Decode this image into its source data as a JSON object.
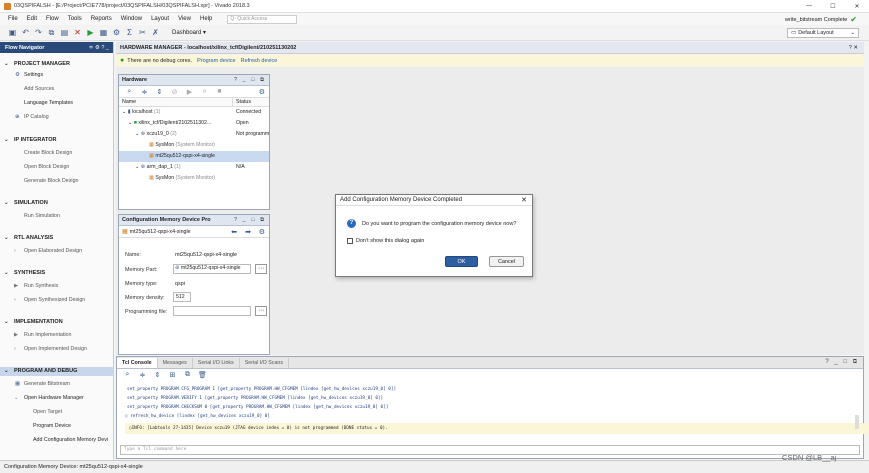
{
  "window": {
    "title": "03QSPIFALSH - [E:/Project/PCIE778/project/03QSPIFALSH/03QSPIFALSH.xpr] - Vivado 2018.3",
    "minimize": "—",
    "maximize": "☐",
    "close": "✕"
  },
  "menu": [
    "File",
    "Edit",
    "Flow",
    "Tools",
    "Reports",
    "Window",
    "Layout",
    "View",
    "Help"
  ],
  "quick_access": {
    "placeholder": "Q- Quick Access"
  },
  "status_right": "write_bitstream Complete",
  "toolbar": {
    "dashboard": "Dashboard ▾",
    "layout": "Default Layout"
  },
  "flow_navigator": {
    "title": "Flow Navigator",
    "header_icons": "≑ ⚙ ? _",
    "sections": [
      {
        "label": "PROJECT MANAGER",
        "items": [
          "Settings",
          "Add Sources",
          "Language Templates",
          "IP Catalog"
        ]
      },
      {
        "label": "IP INTEGRATOR",
        "items": [
          "Create Block Design",
          "Open Block Design",
          "Generate Block Design"
        ]
      },
      {
        "label": "SIMULATION",
        "items": [
          "Run Simulation"
        ]
      },
      {
        "label": "RTL ANALYSIS",
        "items": [
          "Open Elaborated Design"
        ]
      },
      {
        "label": "SYNTHESIS",
        "items": [
          "Run Synthesis",
          "Open Synthesized Design"
        ]
      },
      {
        "label": "IMPLEMENTATION",
        "items": [
          "Run Implementation",
          "Open Implemented Design"
        ]
      },
      {
        "label": "PROGRAM AND DEBUG",
        "items": [
          "Generate Bitstream",
          "Open Hardware Manager",
          "Open Target",
          "Program Device",
          "Add Configuration Memory Devi"
        ]
      }
    ]
  },
  "hardware_manager": {
    "header": "HARDWARE MANAGER - localhost/xilinx_tcf/Digilent/210251130202",
    "info": "There are no debug cores.",
    "link_program": "Program device",
    "link_refresh": "Refresh device"
  },
  "hardware_panel": {
    "title": "Hardware",
    "header_icons": "? _ □ ⧉",
    "columns": [
      "Name",
      "Status"
    ],
    "rows": [
      {
        "name": "localhost",
        "count": "(1)",
        "status": "Connected"
      },
      {
        "name": "xilinx_tcf/Digilent/2102511302...",
        "count": "",
        "status": "Open"
      },
      {
        "name": "xczu19_0",
        "count": "(2)",
        "status": "Not programmed"
      },
      {
        "name": "SysMon",
        "count": "(System Monitor)",
        "status": ""
      },
      {
        "name": "mt25qu512-qspi-x4-single",
        "count": "",
        "status": ""
      },
      {
        "name": "arm_dap_1",
        "count": "(1)",
        "status": "N/A"
      },
      {
        "name": "SysMon",
        "count": "(System Monitor)",
        "status": ""
      }
    ]
  },
  "config_panel": {
    "title": "Configuration Memory Device Pro",
    "header_icons": "? _ □ ⧉",
    "device": "mt25qu512-qspi-x4-single",
    "fields": {
      "name_label": "Name:",
      "name_value": "mt25qu512-qspi-x4-single",
      "part_label": "Memory Part:",
      "part_value": "mt25qu512-qspi-x4-single",
      "type_label": "Memory type:",
      "type_value": "qspi",
      "density_label": "Memory density:",
      "density_value": "512",
      "progfile_label": "Programming file:",
      "progfile_value": ""
    }
  },
  "dialog": {
    "title": "Add Configuration Memory Device Completed",
    "message": "Do you want to program the configuration memory device now?",
    "checkbox": "Don't show this dialog again",
    "ok": "OK",
    "cancel": "Cancel"
  },
  "console": {
    "tabs": [
      "Tcl Console",
      "Messages",
      "Serial I/O Links",
      "Serial I/O Scans"
    ],
    "header_icons": "? _ □ ⧉",
    "lines": [
      "set_property PROGRAM.CFG_PROGRAM  1 [get_property PROGRAM.HW_CFGMEM [lindex [get_hw_devices xczu19_0] 0]]",
      "set_property PROGRAM.VERIFY  1 [get_property PROGRAM.HW_CFGMEM [lindex [get_hw_devices xczu19_0] 0]]",
      "set_property PROGRAM.CHECKSUM  0 [get_property PROGRAM.HW_CFGMEM [lindex [get_hw_devices xczu19_0] 0]]",
      "refresh_hw_device [lindex [get_hw_devices xczu19_0] 0]",
      "INFO: [Labtools 27-1435] Device xczu19 (JTAG device index = 0) is not programmed (DONE status = 0)."
    ],
    "input_placeholder": "Type a Tcl command here"
  },
  "statusbar": "Configuration Memory Device: mt25qu512-qspi-x4-single",
  "watermark": "CSDN @LB__aj"
}
